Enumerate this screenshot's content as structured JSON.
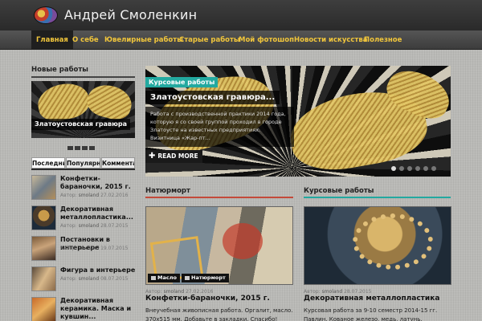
{
  "header": {
    "site_title": "Андрей Смоленкин",
    "logo_icon": "palette-logo-icon"
  },
  "nav": {
    "items": [
      {
        "label": "Главная",
        "active": true
      },
      {
        "label": "О себе"
      },
      {
        "label": "Ювелирные работы"
      },
      {
        "label": "Старые работы"
      },
      {
        "label": "Мой фотошоп"
      },
      {
        "label": "Новости искусства"
      },
      {
        "label": "Полезное"
      }
    ]
  },
  "sidebar": {
    "new_works_heading": "Новые работы",
    "slider_caption": "Златоустовская гравюра",
    "tabs": [
      "Последние",
      "Популярные",
      "Комментарии"
    ],
    "posts": [
      {
        "title": "Конфетки-бараночки, 2015 г.",
        "author_label": "Автор:",
        "author": "smoland",
        "date": "27.02.2016"
      },
      {
        "title": "Декоративная металлопластика...",
        "author_label": "Автор:",
        "author": "smoland",
        "date": "28.07.2015"
      },
      {
        "title": "Постановки в интерьере",
        "author_label": "Автор:",
        "author": "smoland",
        "date": "19.07.2015"
      },
      {
        "title": "Фигура в интерьере",
        "author_label": "Автор:",
        "author": "smoland",
        "date": "08.07.2015"
      },
      {
        "title": "Декоративная керамика. Маска и кувшин...",
        "author_label": "",
        "author": "",
        "date": ""
      }
    ]
  },
  "hero": {
    "category": "Курсовые работы",
    "title": "Златоустовская гравюра...",
    "excerpt": "Работа с производственной практики 2014 года, которую я со своей группой проходил в городе Златоусте на известных предприятиях. Визитница «Жар-пт...",
    "read_more": "READ MORE"
  },
  "sections": {
    "left": {
      "heading": "Натюрморт",
      "rule_color": "#c44a3a",
      "tags": [
        "Масло",
        "Натюрморт"
      ],
      "meta_author_label": "Автор:",
      "meta_author": "smoland",
      "meta_date": "27.02.2016",
      "title": "Конфетки-бараночки, 2015 г.",
      "text": "Внеучебная живописная работа. Оргалит, масло. 370х515 мм. Добавьте в закладки. Спасибо!"
    },
    "right": {
      "heading": "Курсовые работы",
      "rule_color": "#23a9a0",
      "meta_author_label": "Автор:",
      "meta_author": "smoland",
      "meta_date": "28.07.2015",
      "title": "Декоративная металлопластика",
      "text": "Курсовая работа за 9-10 семестр 2014-15 гг. Павлин. Кованое железо, медь, латунь."
    }
  }
}
